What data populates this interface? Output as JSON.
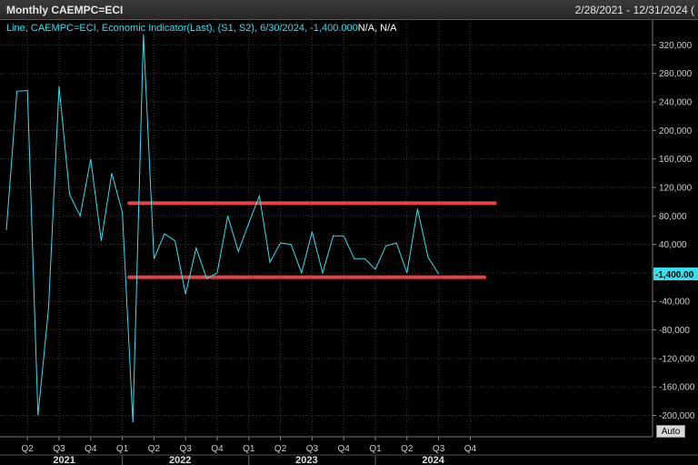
{
  "window": {
    "title": "Monthly CAEMPC=ECI",
    "date_range": "2/28/2021 - 12/31/2024 ("
  },
  "legend": {
    "text": "Line, CAEMPC=ECI, Economic Indicator(Last), (S1, S2), 6/30/2024, -1,400.000",
    "suffix": "N/A, N/A"
  },
  "auto_label": "Auto",
  "colors": {
    "background": "#000000",
    "series": "#33e0f0",
    "support": "#e8423f",
    "grid": "#3b3b3b",
    "last_value_bg": "#33e0f0"
  },
  "chart_data": {
    "type": "line",
    "x": [
      "2021-02",
      "2021-03",
      "2021-04",
      "2021-05",
      "2021-06",
      "2021-07",
      "2021-08",
      "2021-09",
      "2021-10",
      "2021-11",
      "2021-12",
      "2022-01",
      "2022-02",
      "2022-03",
      "2022-04",
      "2022-05",
      "2022-06",
      "2022-07",
      "2022-08",
      "2022-09",
      "2022-10",
      "2022-11",
      "2022-12",
      "2023-01",
      "2023-02",
      "2023-03",
      "2023-04",
      "2023-05",
      "2023-06",
      "2023-07",
      "2023-08",
      "2023-09",
      "2023-10",
      "2023-11",
      "2023-12",
      "2024-01",
      "2024-02",
      "2024-03",
      "2024-04",
      "2024-05",
      "2024-06"
    ],
    "series": [
      {
        "values": [
          60000,
          255000,
          256000,
          -200000,
          -50000,
          262000,
          110000,
          80000,
          160000,
          45000,
          140000,
          85000,
          -210000,
          335000,
          20000,
          55000,
          45000,
          -30000,
          35000,
          -8000,
          0,
          80000,
          30000,
          70000,
          108000,
          15000,
          42000,
          40000,
          0,
          58000,
          0,
          52000,
          52000,
          20000,
          20000,
          5000,
          38000,
          42000,
          0,
          90000,
          22000,
          -1400
        ]
      }
    ],
    "xlabel": "",
    "ylabel": "",
    "ylim": [
      -230000,
      355000
    ],
    "yticks": [
      320000,
      280000,
      240000,
      200000,
      160000,
      120000,
      80000,
      40000,
      0,
      -40000,
      -80000,
      -120000,
      -160000,
      -200000
    ],
    "ytick_labels": [
      "320,000",
      "280,000",
      "240,000",
      "200,000",
      "160,000",
      "120,000",
      "80,000",
      "40,000",
      "",
      "-40,000",
      "-80,000",
      "-120,000",
      "-160,000",
      "-200,000"
    ],
    "quarter_ticks": [
      {
        "label": "Q2",
        "date": "2021-04"
      },
      {
        "label": "Q3",
        "date": "2021-07"
      },
      {
        "label": "Q4",
        "date": "2021-10"
      },
      {
        "label": "Q1",
        "date": "2022-01"
      },
      {
        "label": "Q2",
        "date": "2022-04"
      },
      {
        "label": "Q3",
        "date": "2022-07"
      },
      {
        "label": "Q4",
        "date": "2022-10"
      },
      {
        "label": "Q1",
        "date": "2023-01"
      },
      {
        "label": "Q2",
        "date": "2023-04"
      },
      {
        "label": "Q3",
        "date": "2023-07"
      },
      {
        "label": "Q4",
        "date": "2023-10"
      },
      {
        "label": "Q1",
        "date": "2024-01"
      },
      {
        "label": "Q2",
        "date": "2024-04"
      },
      {
        "label": "Q3",
        "date": "2024-07"
      },
      {
        "label": "Q4",
        "date": "2024-10"
      }
    ],
    "year_labels": [
      {
        "label": "2021",
        "date": "2021-08"
      },
      {
        "label": "2022",
        "date": "2022-07"
      },
      {
        "label": "2023",
        "date": "2023-07"
      },
      {
        "label": "2024",
        "date": "2024-07"
      }
    ],
    "last_value": {
      "label": "-1,400.00",
      "value": -1400
    },
    "horizontal_lines": [
      {
        "value": 98000,
        "from": "2022-02",
        "to": "2024-12"
      },
      {
        "value": -6000,
        "from": "2022-02",
        "to": "2024-11"
      }
    ],
    "grid": true
  }
}
